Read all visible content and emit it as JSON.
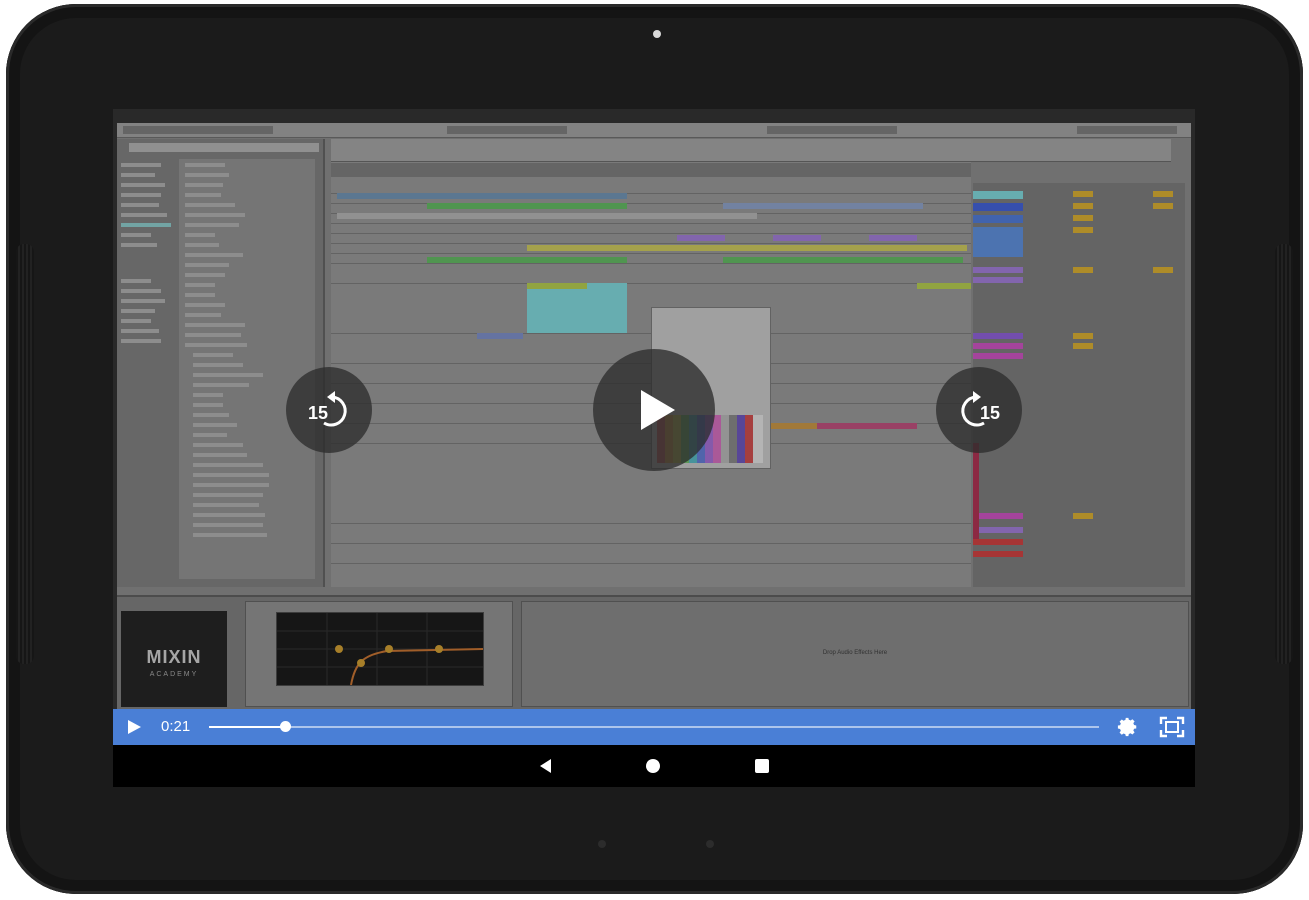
{
  "player": {
    "time_elapsed": "0:21",
    "progress": 0.085,
    "rewind_label": "15",
    "forward_label": "15",
    "icons": {
      "play": "play-icon",
      "rewind": "rewind-15-icon",
      "forward": "forward-15-icon",
      "settings": "gear-icon",
      "fullscreen": "fullscreen-icon"
    }
  },
  "video_content": {
    "logo_text": "MIXIN",
    "logo_subtext": "ACADEMY",
    "drop_area_text": "Drop Audio Effects Here"
  },
  "android_nav": {
    "icons": [
      "back-icon",
      "home-icon",
      "recents-icon"
    ]
  },
  "colors": {
    "control_bar": "#4a7fd6",
    "overlay_button": "#2d2d2d"
  }
}
